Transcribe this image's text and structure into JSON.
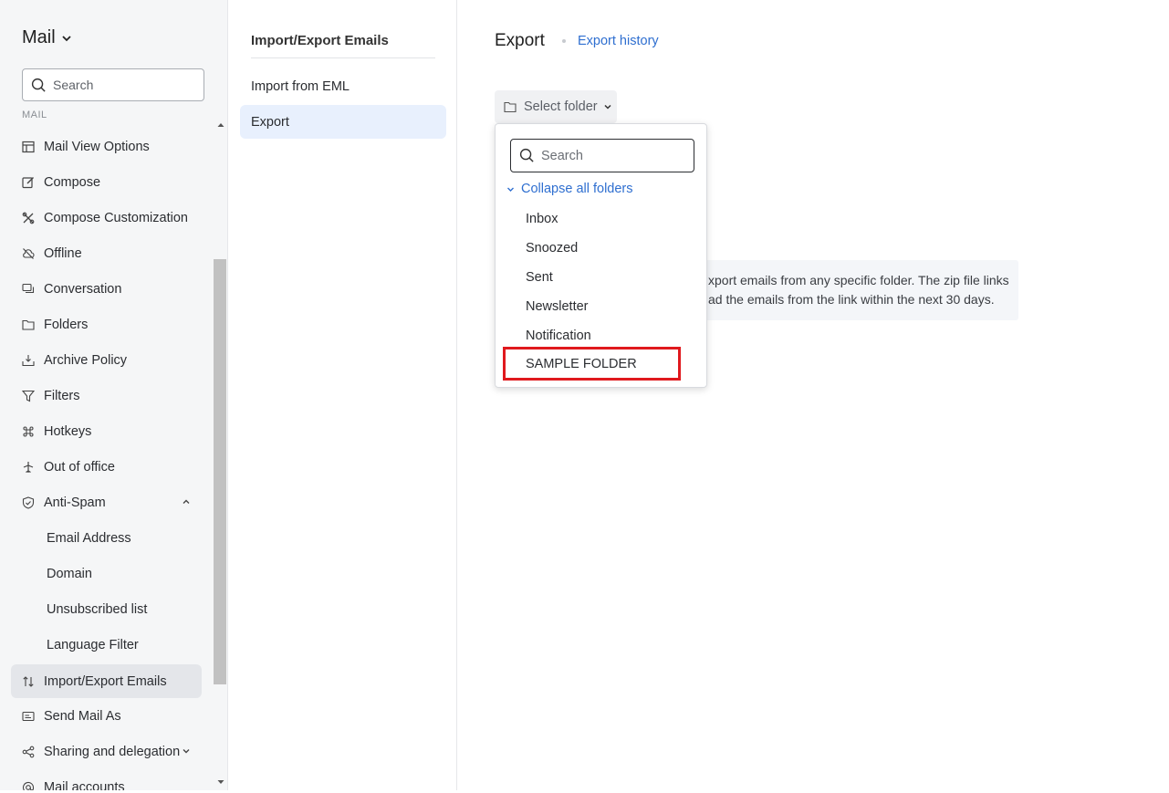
{
  "sidebar": {
    "app_title": "Mail",
    "search_placeholder": "Search",
    "section_label": "MAIL",
    "items": [
      {
        "label": "Mail View Options",
        "icon": "layout-icon"
      },
      {
        "label": "Compose",
        "icon": "edit-icon"
      },
      {
        "label": "Compose Customization",
        "icon": "tools-icon"
      },
      {
        "label": "Offline",
        "icon": "cloud-off-icon"
      },
      {
        "label": "Conversation",
        "icon": "chat-icon"
      },
      {
        "label": "Folders",
        "icon": "folder-icon"
      },
      {
        "label": "Archive Policy",
        "icon": "archive-icon"
      },
      {
        "label": "Filters",
        "icon": "filter-icon"
      },
      {
        "label": "Hotkeys",
        "icon": "command-icon"
      },
      {
        "label": "Out of office",
        "icon": "plane-icon"
      },
      {
        "label": "Anti-Spam",
        "icon": "shield-icon"
      },
      {
        "label": "Email Address"
      },
      {
        "label": "Domain"
      },
      {
        "label": "Unsubscribed list"
      },
      {
        "label": "Language Filter"
      },
      {
        "label": "Import/Export Emails",
        "icon": "import-export-icon",
        "active": true
      },
      {
        "label": "Send Mail As",
        "icon": "send-as-icon"
      },
      {
        "label": "Sharing and delegation",
        "icon": "share-icon"
      },
      {
        "label": "Mail accounts",
        "icon": "at-icon"
      }
    ]
  },
  "middle": {
    "title": "Import/Export Emails",
    "items": [
      {
        "label": "Import from EML"
      },
      {
        "label": "Export",
        "active": true
      }
    ]
  },
  "main": {
    "title": "Export",
    "history_link": "Export history",
    "select_folder_label": "Select folder",
    "info_line1": "xport emails from any specific folder. The zip file links",
    "info_line2": "ad the emails from the link within the next 30 days."
  },
  "dropdown": {
    "search_placeholder": "Search",
    "collapse_label": "Collapse all folders",
    "folders": [
      "Inbox",
      "Snoozed",
      "Sent",
      "Newsletter",
      "Notification",
      "SAMPLE FOLDER"
    ],
    "highlighted_folder": "SAMPLE FOLDER"
  },
  "colors": {
    "accent": "#2f6fd0",
    "active_bg": "#e4e6ea",
    "middle_active_bg": "#e8f0fd",
    "highlight": "#e0191e"
  }
}
